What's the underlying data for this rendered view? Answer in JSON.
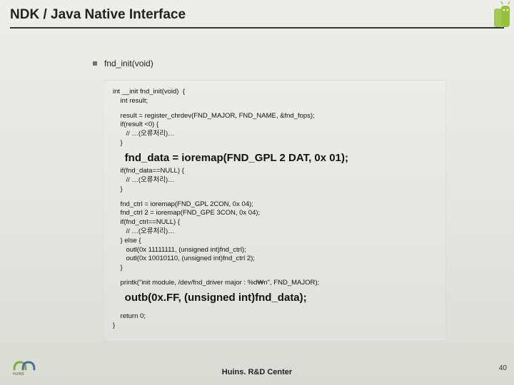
{
  "header": {
    "title": "NDK / Java Native Interface"
  },
  "bullet": {
    "label": "fnd_init(void)"
  },
  "code": {
    "l1": "int __init fnd_init(void)  {",
    "l2": "    int result;",
    "l3": "    result = register_chrdev(FND_MAJOR, FND_NAME, &fnd_fops);",
    "l4": "    if(result <0) {",
    "l5": "       // …(오류처리)…",
    "l6": "    }",
    "big1": "    fnd_data = ioremap(FND_GPL 2 DAT, 0x 01);",
    "l7": "    if(fnd_data==NULL) {",
    "l8": "       // …(오류처리)…",
    "l9": "    }",
    "l10": "    fnd_ctrl = ioremap(FND_GPL 2CON, 0x 04);",
    "l11": "    fnd_ctrl 2 = ioremap(FND_GPE 3CON, 0x 04);",
    "l12": "    if(fnd_ctrl==NULL) {",
    "l13": "       // …(오류처리)…",
    "l14": "    } else {",
    "l15": "       outl(0x 11111111, (unsigned int)fnd_ctrl);",
    "l16": "       outl(0x 10010110, (unsigned int)fnd_ctrl 2);",
    "l17": "    }",
    "l18": "    printk(\"init module, /dev/fnd_driver major : %d₩n\", FND_MAJOR);",
    "big2": "    outb(0x.FF, (unsigned int)fnd_data);",
    "l19": "    return 0;",
    "l20": "}"
  },
  "footer": {
    "center": "Huins. R&D Center",
    "page": "40"
  },
  "colors": {
    "bullet": "#6d7a5d",
    "android_body": "#97c13c"
  }
}
